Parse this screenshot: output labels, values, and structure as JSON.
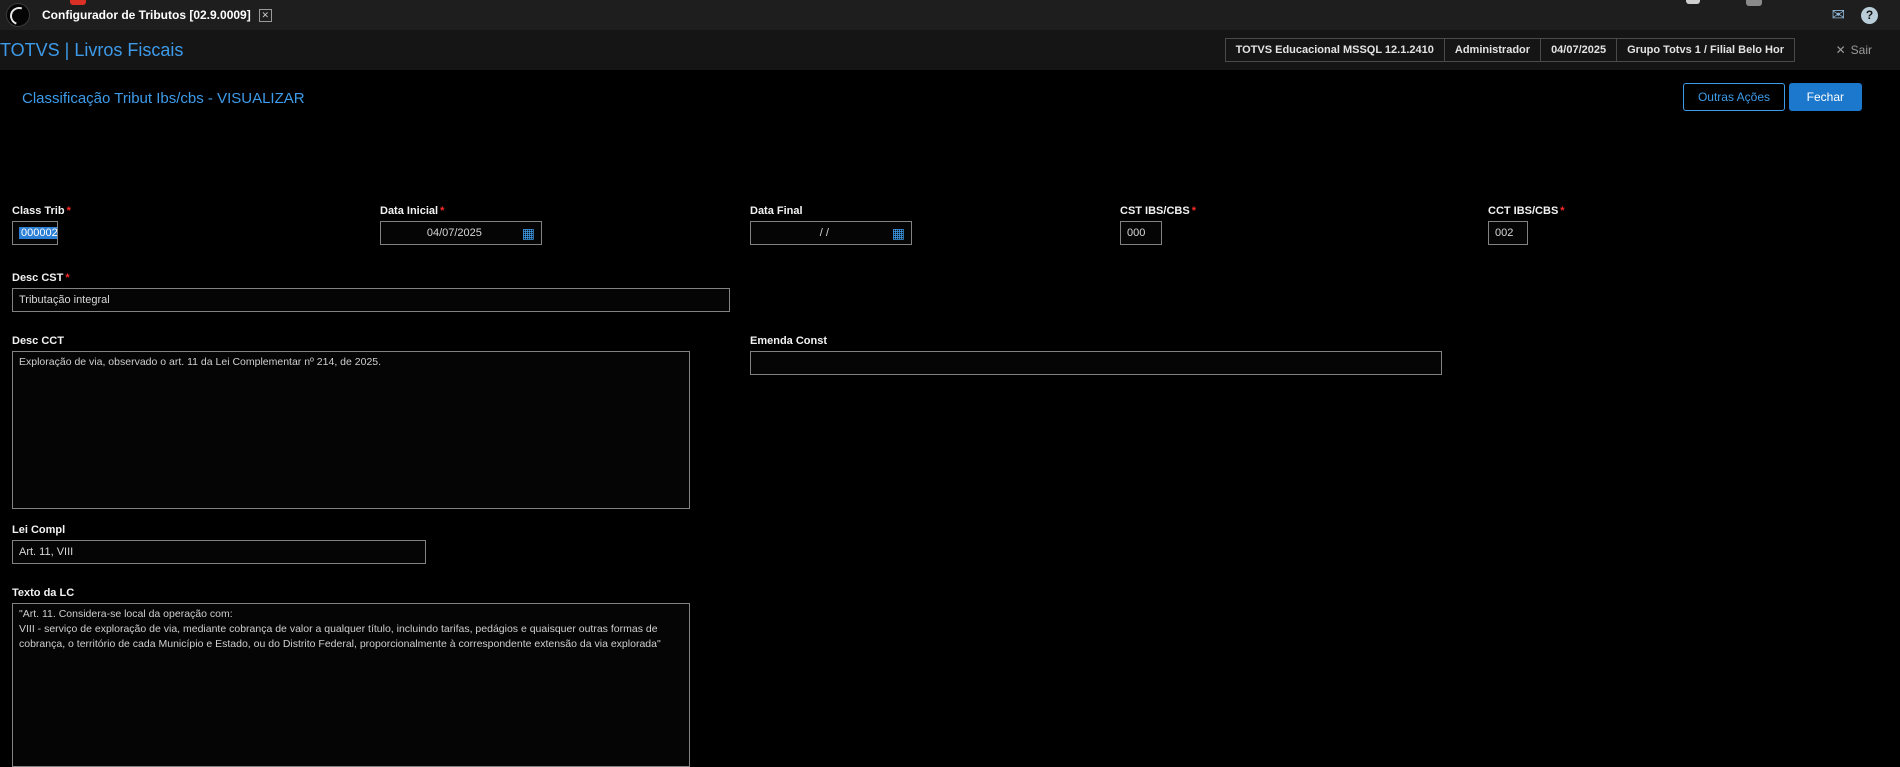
{
  "topbar": {
    "tab_label": "Configurador de Tributos [02.9.0009]"
  },
  "header": {
    "brand": "TOTVS | Livros Fiscais",
    "cells": [
      "TOTVS Educacional MSSQL 12.1.2410",
      "Administrador",
      "04/07/2025",
      "Grupo Totvs 1 / Filial Belo Hor"
    ],
    "exit_label": "Sair"
  },
  "page": {
    "title": "Classificação Tribut Ibs/cbs - VISUALIZAR",
    "other_actions_label": "Outras Ações",
    "close_label": "Fechar"
  },
  "form": {
    "required_marker": "*",
    "class_trib": {
      "label": "Class Trib",
      "value": "000002"
    },
    "data_inicial": {
      "label": "Data Inicial",
      "value": "04/07/2025"
    },
    "data_final": {
      "label": "Data Final",
      "value": "/  /"
    },
    "cst_ibs_cbs": {
      "label": "CST IBS/CBS",
      "value": "000"
    },
    "cct_ibs_cbs": {
      "label": "CCT IBS/CBS",
      "value": "002"
    },
    "desc_cst": {
      "label": "Desc CST",
      "value": "Tributação integral"
    },
    "desc_cct": {
      "label": "Desc CCT",
      "value": "Exploração de via, observado o art. 11 da Lei Complementar nº 214, de 2025."
    },
    "emenda_const": {
      "label": "Emenda Const",
      "value": ""
    },
    "lei_compl": {
      "label": "Lei Compl",
      "value": "Art. 11, VIII"
    },
    "texto_lc": {
      "label": "Texto da LC",
      "value": "\"Art. 11. Considera-se local da operação com:\nVIII - serviço de exploração de via, mediante cobrança de valor a qualquer título, incluindo tarifas, pedágios e quaisquer outras formas de cobrança, o território de cada Município e Estado, ou do Distrito Federal, proporcionalmente à correspondente extensão da via explorada\""
    }
  },
  "icons": {
    "close": "✕",
    "mail": "✉",
    "help": "?",
    "calendar": "▦",
    "exit": "✕"
  },
  "colors": {
    "accent": "#3d9be9",
    "primary_button": "#1b78cc",
    "required": "#ff2b2b"
  }
}
